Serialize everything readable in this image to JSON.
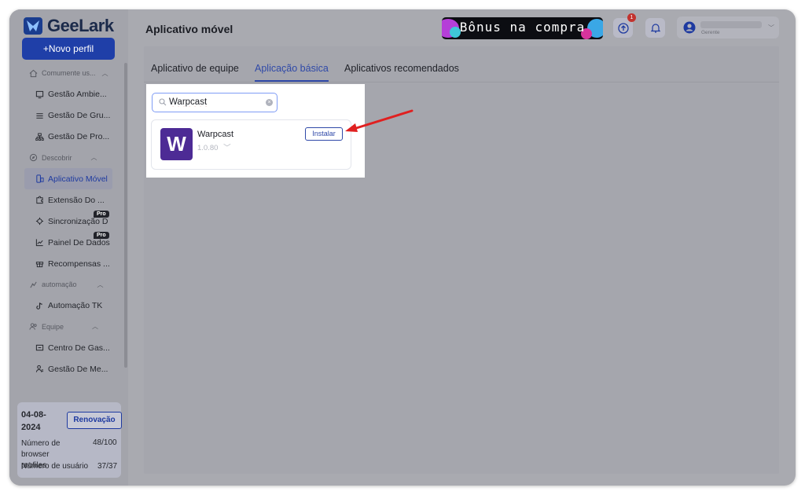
{
  "app": {
    "brand": "GeeLark",
    "new_profile_label": "+Novo perfil"
  },
  "sidebar": {
    "sections": [
      {
        "label": "Comumente us...",
        "items": [
          "Gestão Ambie...",
          "Gestão De Gru...",
          "Gestão De Pro..."
        ]
      },
      {
        "label": "Descobrir",
        "items": [
          "Aplicativo Móvel",
          "Extensão Do ...",
          "Sincronização D",
          "Painel De Dados",
          "Recompensas ..."
        ]
      },
      {
        "label": "automação",
        "items": [
          "Automação TK"
        ]
      },
      {
        "label": "Equipe",
        "items": [
          "Centro De Gas...",
          "Gestão De Me..."
        ]
      }
    ],
    "pro_label": "Pro",
    "active_item": "Aplicativo Móvel"
  },
  "info_card": {
    "date": "04-08-2024",
    "renew_label": "Renovação",
    "browser_profiles_label": "Número de browser profiles",
    "browser_profiles_value": "48/100",
    "users_label": "Número de usuário",
    "users_value": "37/37"
  },
  "header": {
    "title": "Aplicativo móvel",
    "promo_text": "Bônus na compra",
    "upload_badge": "1",
    "user_role": "Gerente"
  },
  "tabs": [
    {
      "label": "Aplicativo de equipe",
      "active": false
    },
    {
      "label": "Aplicação básica",
      "active": true
    },
    {
      "label": "Aplicativos recomendados",
      "active": false
    }
  ],
  "search": {
    "value": "Warpcast"
  },
  "app_result": {
    "logo_letter": "W",
    "name": "Warpcast",
    "version": "1.0.80",
    "install_label": "Instalar"
  },
  "colors": {
    "accent": "#1f3fa8",
    "app_logo": "#4d2b95",
    "arrow": "#e02020"
  }
}
